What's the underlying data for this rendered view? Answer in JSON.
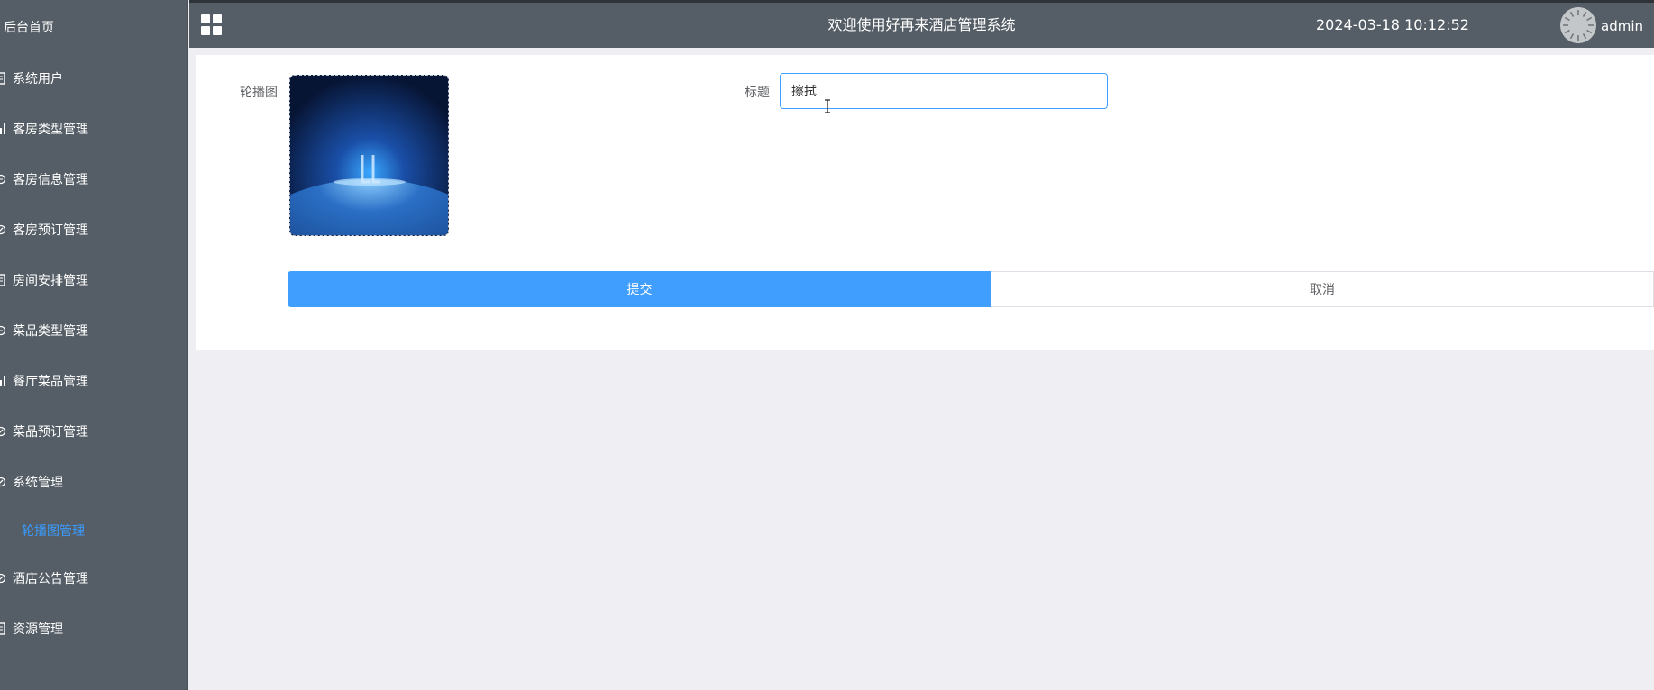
{
  "sidebar": {
    "home": "后台首页",
    "items": [
      {
        "label": "系统用户",
        "icon": "document-icon"
      },
      {
        "label": "客房类型管理",
        "icon": "bar-chart-icon"
      },
      {
        "label": "客房信息管理",
        "icon": "comment-icon"
      },
      {
        "label": "客房预订管理",
        "icon": "compass-icon"
      },
      {
        "label": "房间安排管理",
        "icon": "document-icon"
      },
      {
        "label": "菜品类型管理",
        "icon": "comment-icon"
      },
      {
        "label": "餐厅菜品管理",
        "icon": "bar-chart-icon"
      },
      {
        "label": "菜品预订管理",
        "icon": "compass-icon"
      },
      {
        "label": "系统管理",
        "icon": "compass-icon"
      },
      {
        "label": "酒店公告管理",
        "icon": "compass-icon"
      },
      {
        "label": "资源管理",
        "icon": "document-icon"
      }
    ],
    "active_sub": "轮播图管理"
  },
  "header": {
    "title": "欢迎使用好再来酒店管理系统",
    "datetime": "2024-03-18 10:12:52",
    "username": "admin"
  },
  "form": {
    "image_label": "轮播图",
    "title_label": "标题",
    "title_value": "擦拭",
    "submit_label": "提交",
    "cancel_label": "取消"
  },
  "colors": {
    "sidebar_bg": "#555e66",
    "primary": "#409eff",
    "active_sub": "#3a9bff"
  }
}
